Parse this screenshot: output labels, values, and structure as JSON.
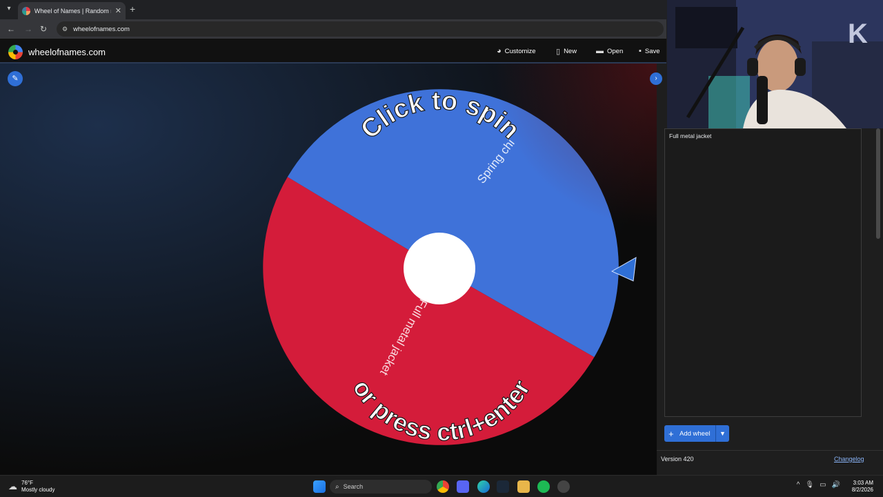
{
  "browser": {
    "tab_title": "Wheel of Names | Random nam",
    "url": "wheelofnames.com"
  },
  "header": {
    "site_name": "wheelofnames.com",
    "menu": [
      {
        "label": "Customize",
        "icon": "palette-icon"
      },
      {
        "label": "New",
        "icon": "file-icon"
      },
      {
        "label": "Open",
        "icon": "folder-icon"
      },
      {
        "label": "Save",
        "icon": "save-icon"
      }
    ]
  },
  "wheel": {
    "top_text": "Click to spin",
    "bottom_text": "or press ctrl+enter",
    "entries": [
      {
        "label": "Full metal jacket",
        "color": "#d41c3a"
      },
      {
        "label": "Spring chi",
        "color": "#3f72d9"
      }
    ],
    "pointer_color": "#2f6fd6"
  },
  "panel": {
    "entries": [
      "Full metal jacket"
    ],
    "add_wheel_label": "Add wheel",
    "version": "Version 420",
    "changelog": "Changelog"
  },
  "taskbar": {
    "temp": "76°F",
    "weather": "Mostly cloudy",
    "search": "Search",
    "time": "3:03 AM",
    "date": "8/2/2026"
  },
  "colors": {
    "accent": "#2f6fd6",
    "wheel_blue": "#3f72d9",
    "wheel_red": "#d41c3a"
  }
}
